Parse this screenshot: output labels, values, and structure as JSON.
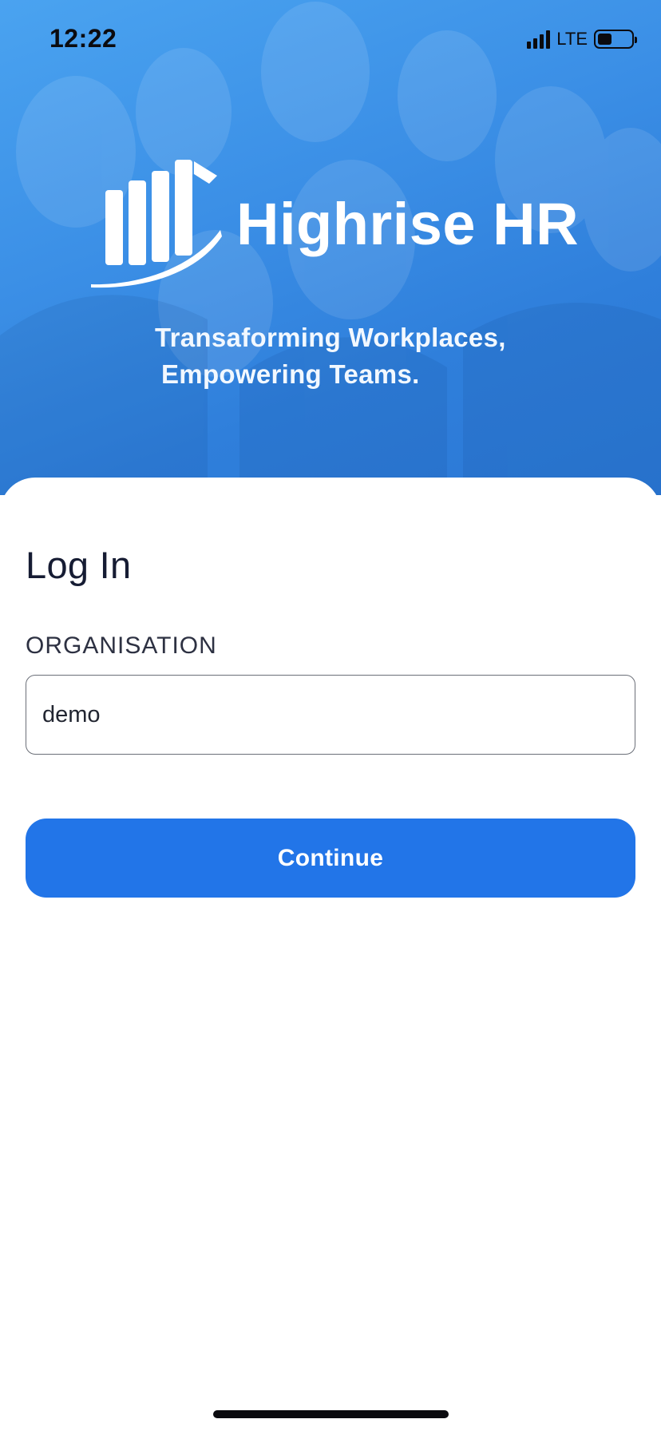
{
  "status_bar": {
    "time": "12:22",
    "network": "LTE",
    "signal_bars": 4,
    "battery_level": 0.4
  },
  "brand": {
    "name": "Highrise HR",
    "tagline_line1": "Transaforming Workplaces,",
    "tagline_line2": "Empowering Teams.",
    "logo_icon": "bar-chart-swoosh-icon"
  },
  "login": {
    "title": "Log In",
    "organisation_label": "ORGANISATION",
    "organisation_value": "demo",
    "continue_label": "Continue"
  },
  "colors": {
    "hero_blue": "#3b8fe6",
    "primary_button": "#2275e8",
    "title_text": "#161c33"
  }
}
